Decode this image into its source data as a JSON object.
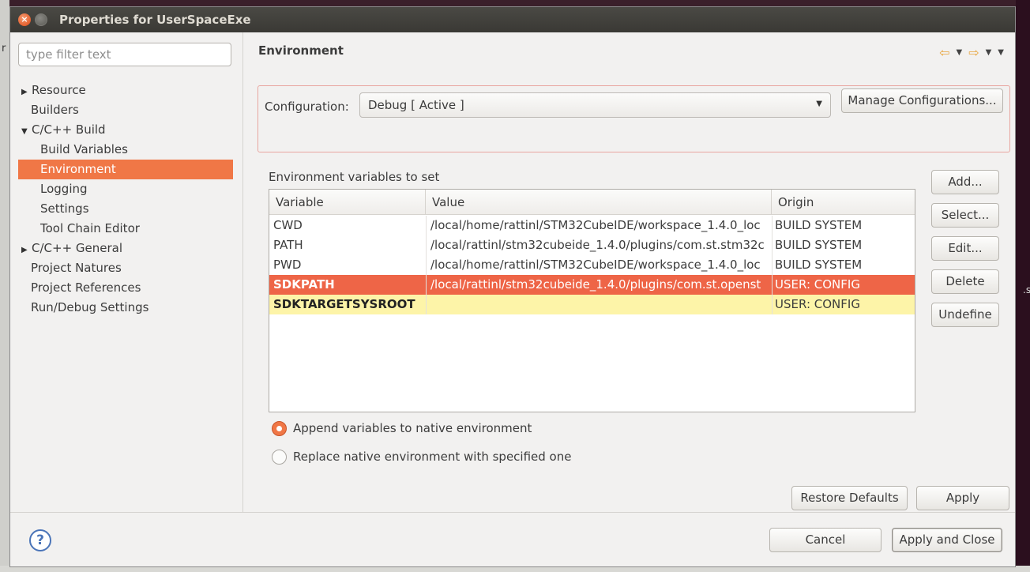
{
  "window": {
    "title": "Properties for UserSpaceExe"
  },
  "background": {
    "left_mark": "r",
    "right_mark": ".s"
  },
  "filter": {
    "placeholder": "type filter text",
    "value": ""
  },
  "tree": [
    {
      "label": "Resource",
      "level": 0,
      "arrow": "right"
    },
    {
      "label": "Builders",
      "level": 0,
      "arrow": "none"
    },
    {
      "label": "C/C++ Build",
      "level": 0,
      "arrow": "down"
    },
    {
      "label": "Build Variables",
      "level": 1
    },
    {
      "label": "Environment",
      "level": 1,
      "selected": true
    },
    {
      "label": "Logging",
      "level": 1
    },
    {
      "label": "Settings",
      "level": 1
    },
    {
      "label": "Tool Chain Editor",
      "level": 1
    },
    {
      "label": "C/C++ General",
      "level": 0,
      "arrow": "right"
    },
    {
      "label": "Project Natures",
      "level": 0,
      "arrow": "none"
    },
    {
      "label": "Project References",
      "level": 0,
      "arrow": "none"
    },
    {
      "label": "Run/Debug Settings",
      "level": 0,
      "arrow": "none"
    }
  ],
  "page": {
    "title": "Environment"
  },
  "config": {
    "label": "Configuration:",
    "selected": "Debug [ Active ]",
    "manage_label": "Manage Configurations..."
  },
  "env": {
    "section_label": "Environment variables to set",
    "columns": {
      "variable": "Variable",
      "value": "Value",
      "origin": "Origin"
    },
    "rows": [
      {
        "variable": "CWD",
        "value": "/local/home/rattinl/STM32CubeIDE/workspace_1.4.0_loc",
        "origin": "BUILD SYSTEM"
      },
      {
        "variable": "PATH",
        "value": "/local/rattinl/stm32cubeide_1.4.0/plugins/com.st.stm32c",
        "origin": "BUILD SYSTEM"
      },
      {
        "variable": "PWD",
        "value": "/local/home/rattinl/STM32CubeIDE/workspace_1.4.0_loc",
        "origin": "BUILD SYSTEM"
      },
      {
        "variable": "SDKPATH",
        "value": "/local/rattinl/stm32cubeide_1.4.0/plugins/com.st.openst",
        "origin": "USER: CONFIG",
        "state": "selected"
      },
      {
        "variable": "SDKTARGETSYSROOT",
        "value": "",
        "origin": "USER: CONFIG",
        "state": "highlight"
      }
    ]
  },
  "side_buttons": {
    "add": "Add...",
    "select": "Select...",
    "edit": "Edit...",
    "delete": "Delete",
    "undefine": "Undefine"
  },
  "radios": {
    "append": "Append variables to native environment",
    "replace": "Replace native environment with specified one",
    "selected": "append"
  },
  "page_buttons": {
    "restore": "Restore Defaults",
    "apply": "Apply"
  },
  "footer": {
    "help": "?",
    "cancel": "Cancel",
    "apply_close": "Apply and Close"
  },
  "colors": {
    "selection": "#f07746",
    "selected_row": "#ee6547",
    "highlight_row": "#fdf4a8",
    "titlebar": "#3f3e3a"
  }
}
